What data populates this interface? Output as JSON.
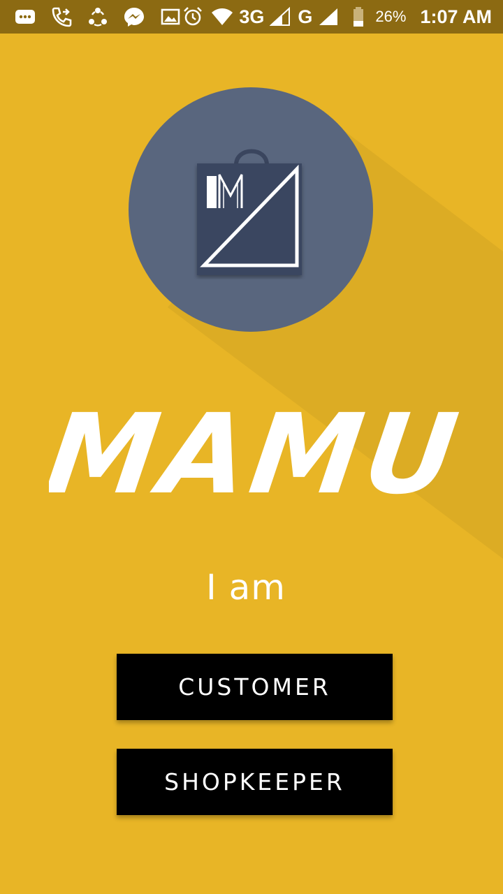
{
  "status_bar": {
    "icons": [
      "message-icon",
      "call-forward-icon",
      "share-icon",
      "messenger-icon",
      "gallery-icon",
      "alarm-icon",
      "wifi-icon",
      "signal-icon",
      "battery-icon"
    ],
    "network_3g": "3G",
    "network_g": "G",
    "battery": "26%",
    "time": "1:07 AM"
  },
  "brand": {
    "name": "MAMU"
  },
  "prompt": "I am",
  "buttons": {
    "customer": "CUSTOMER",
    "shopkeeper": "SHOPKEEPER"
  },
  "colors": {
    "background": "#E8B526",
    "status_bar": "#8C6A12",
    "logo_circle": "#59667E",
    "button": "#000000"
  }
}
